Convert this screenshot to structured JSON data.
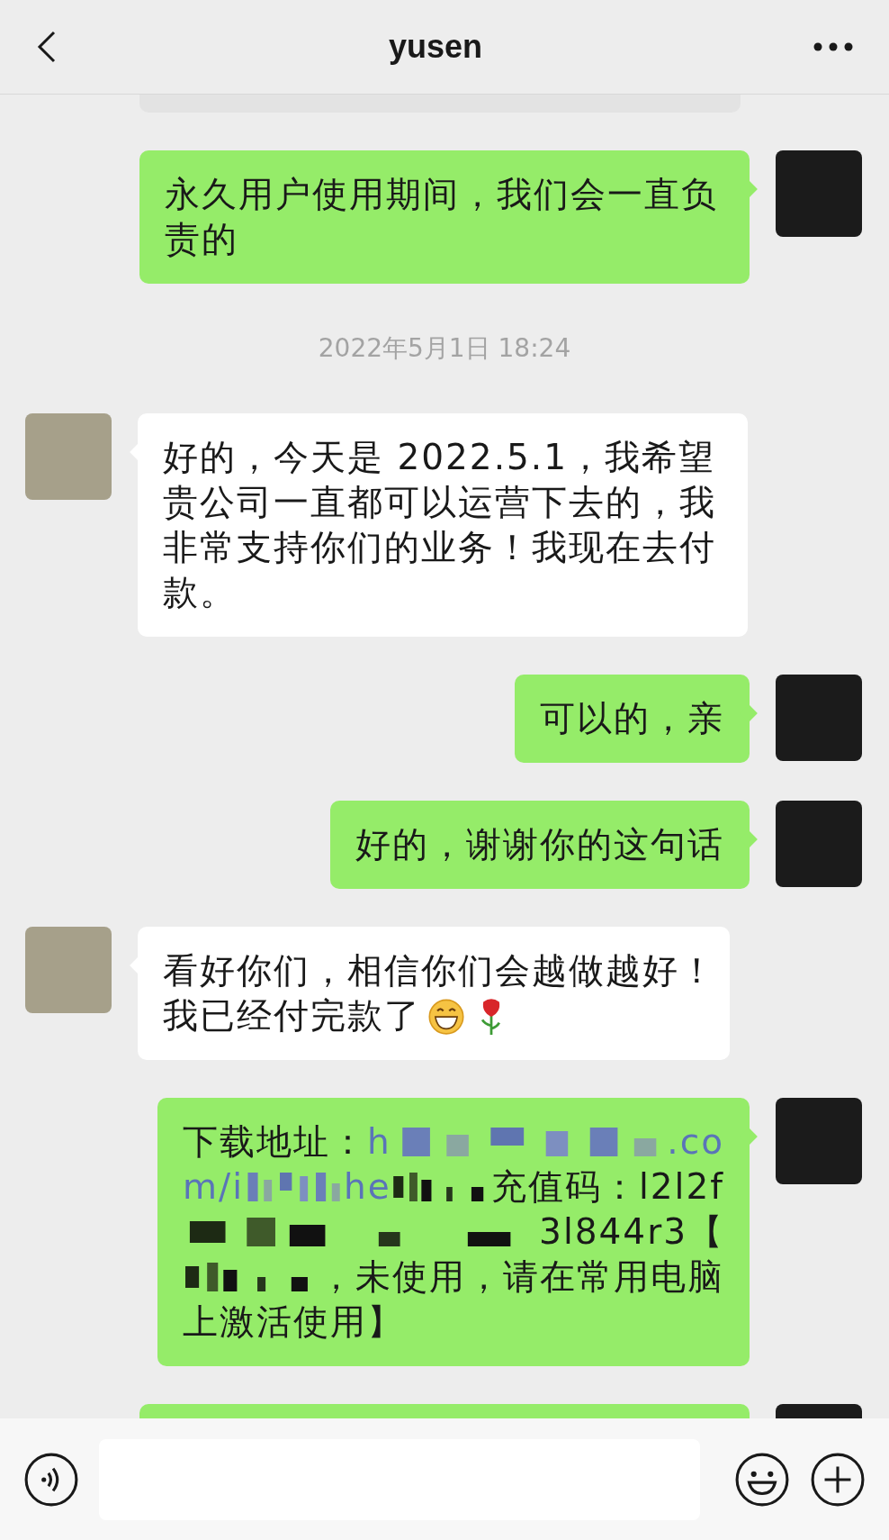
{
  "header": {
    "title": "yusen"
  },
  "chat": [
    {
      "kind": "cut-off"
    },
    {
      "kind": "message",
      "outgoing": true,
      "segments": [
        {
          "kind": "text",
          "text": "永久用户使用期间，我们会一直负责的"
        }
      ]
    },
    {
      "kind": "time",
      "text": "2022年5月1日 18:24"
    },
    {
      "kind": "message",
      "outgoing": false,
      "segments": [
        {
          "kind": "text",
          "text": "好的，今天是 2022.5.1，我希望贵公司一直都可以运营下去的，我非常支持你们的业务！我现在去付款。"
        }
      ]
    },
    {
      "kind": "message",
      "outgoing": true,
      "segments": [
        {
          "kind": "text",
          "text": "可以的，亲"
        }
      ]
    },
    {
      "kind": "message",
      "outgoing": true,
      "segments": [
        {
          "kind": "text",
          "text": "好的，谢谢你的这句话"
        }
      ]
    },
    {
      "kind": "message",
      "outgoing": false,
      "lines": [
        [
          {
            "kind": "text",
            "text": "看好你们，相信你们会越做越好！"
          }
        ],
        [
          {
            "kind": "text",
            "text": "我已经付完款了"
          },
          {
            "kind": "grin"
          },
          {
            "kind": "rose"
          }
        ]
      ]
    },
    {
      "kind": "message",
      "outgoing": true,
      "lines": [
        [
          {
            "kind": "text",
            "text": "下载地址："
          },
          {
            "kind": "link",
            "text": "h"
          },
          {
            "kind": "redacted-link"
          },
          {
            "kind": "link",
            "text": ".co"
          }
        ],
        [
          {
            "kind": "link",
            "text": "m/i"
          },
          {
            "kind": "redacted-link"
          },
          {
            "kind": "link",
            "text": "he"
          },
          {
            "kind": "redacted-text"
          },
          {
            "kind": "text",
            "text": "充值码：l2l2f"
          }
        ],
        [
          {
            "kind": "redacted-text"
          },
          {
            "kind": "text",
            "text": "3l844r3【"
          }
        ],
        [
          {
            "kind": "redacted-text"
          },
          {
            "kind": "text",
            "text": "，未使用，请在常用电脑"
          }
        ],
        [
          {
            "kind": "text",
            "text": "上激活使用】"
          }
        ]
      ]
    },
    {
      "kind": "cut-off",
      "outgoing": true
    }
  ]
}
